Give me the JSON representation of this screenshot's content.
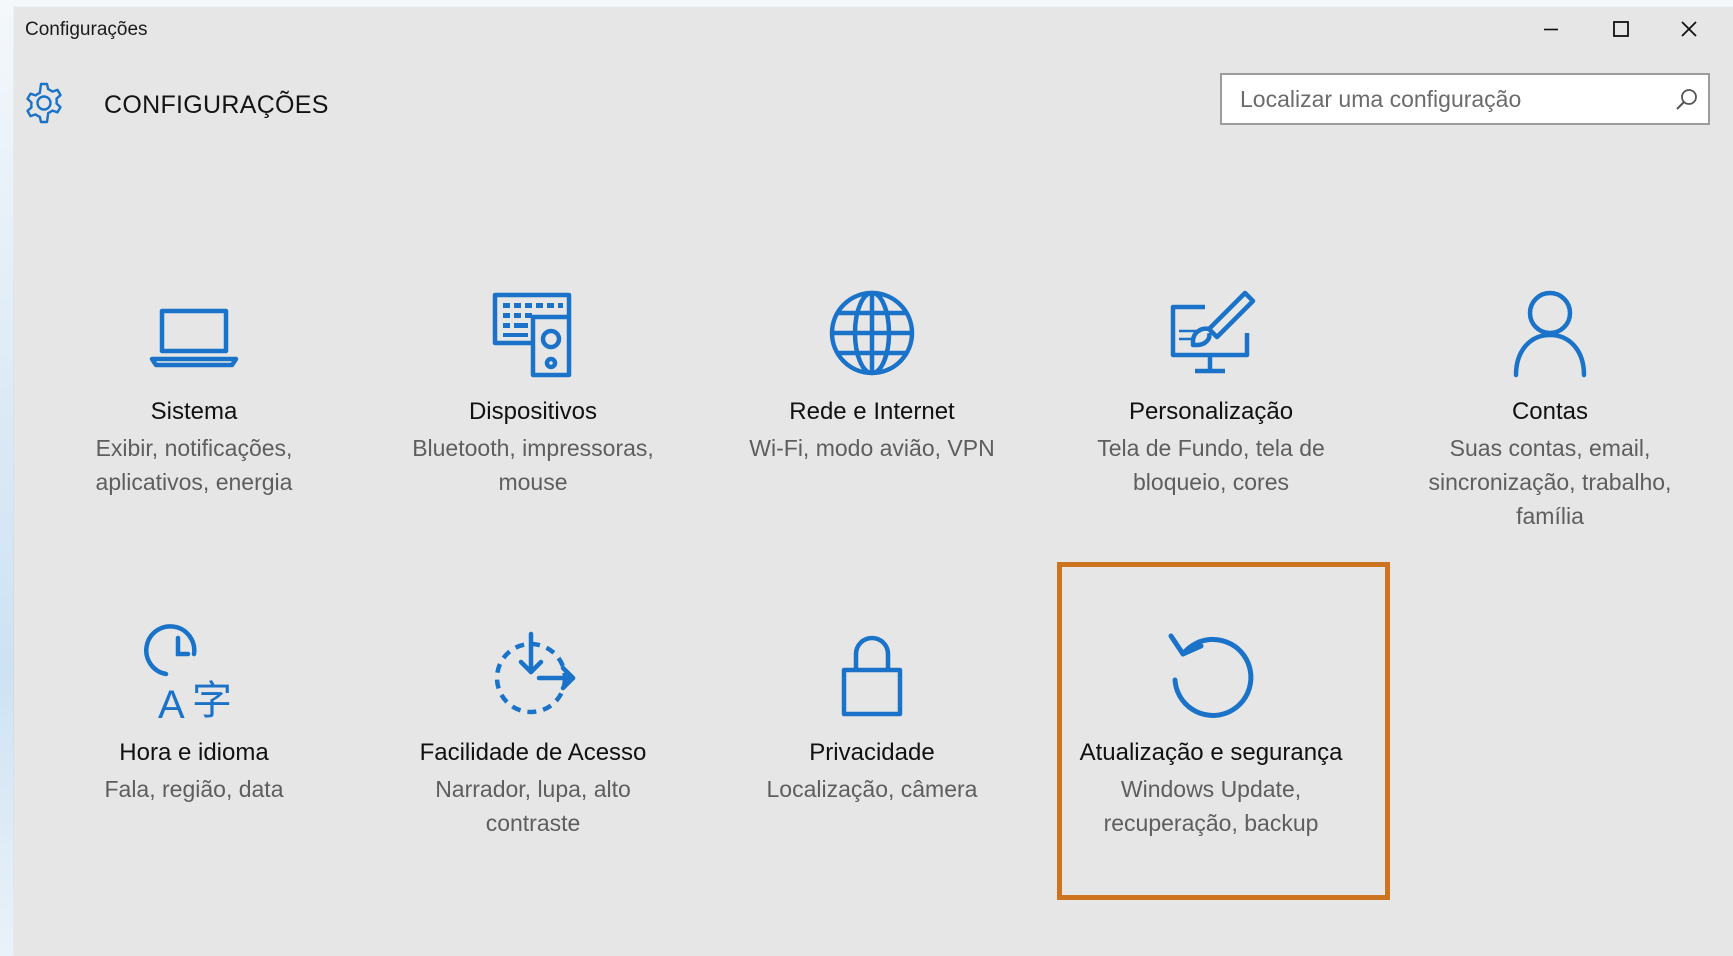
{
  "window": {
    "title": "Configurações",
    "controls": {
      "minimize": "minimize-icon",
      "maximize": "maximize-icon",
      "close": "close-icon"
    }
  },
  "header": {
    "icon": "gear-icon",
    "title": "CONFIGURAÇÕES"
  },
  "search": {
    "placeholder": "Localizar uma configuração",
    "value": "",
    "icon": "search-icon"
  },
  "accent_color": "#1a73c8",
  "highlight_color": "#cc741f",
  "tiles": [
    {
      "name": "Sistema",
      "desc_lines": [
        "Exibir, notificações,",
        "aplicativos, energia"
      ],
      "icon": "laptop-icon"
    },
    {
      "name": "Dispositivos",
      "desc_lines": [
        "Bluetooth, impressoras,",
        "mouse"
      ],
      "icon": "devices-icon"
    },
    {
      "name": "Rede e Internet",
      "desc_lines": [
        "Wi-Fi, modo avião, VPN"
      ],
      "icon": "globe-icon"
    },
    {
      "name": "Personalização",
      "desc_lines": [
        "Tela de Fundo, tela de",
        "bloqueio, cores"
      ],
      "icon": "personalization-icon"
    },
    {
      "name": "Contas",
      "desc_lines": [
        "Suas contas, email,",
        "sincronização, trabalho,",
        "família"
      ],
      "icon": "person-icon"
    },
    {
      "name": "Hora e idioma",
      "desc_lines": [
        "Fala, região, data"
      ],
      "icon": "time-language-icon"
    },
    {
      "name": "Facilidade de Acesso",
      "desc_lines": [
        "Narrador, lupa, alto",
        "contraste"
      ],
      "icon": "ease-of-access-icon"
    },
    {
      "name": "Privacidade",
      "desc_lines": [
        "Localização, câmera"
      ],
      "icon": "lock-icon"
    },
    {
      "name": "Atualização e segurança",
      "desc_lines": [
        "Windows Update,",
        "recuperação, backup"
      ],
      "icon": "update-icon",
      "highlighted": true
    }
  ]
}
